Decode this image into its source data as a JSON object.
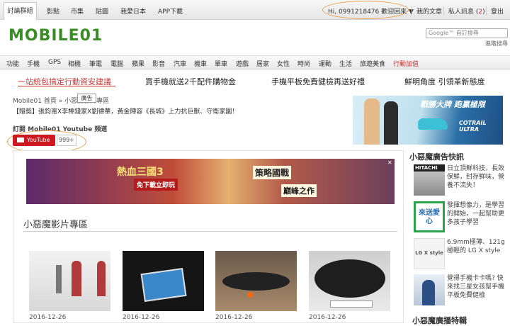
{
  "top_nav": {
    "items": [
      "討論群組",
      "影點",
      "市集",
      "貼圖",
      "我愛日本",
      "APP下載"
    ],
    "greeting": "Hi, 0991218476 歡迎回來",
    "right_items": [
      "我的文章",
      "私人訊息",
      "2",
      "登出"
    ]
  },
  "header": {
    "logo": "MOBILE01",
    "search_placeholder": "Google™ 自訂搜尋",
    "advanced_search": "進階搜尋"
  },
  "categories": [
    "功能",
    "手機",
    "GPS",
    "相機",
    "筆電",
    "電腦",
    "蘋果",
    "影音",
    "汽車",
    "機車",
    "單車",
    "遊戲",
    "居家",
    "女性",
    "時尚",
    "運動",
    "生活",
    "旅遊美食",
    "行動加值"
  ],
  "promo": [
    "一站統包搞定行動資安建議",
    "買手機就送2千配件購物金",
    "手機平板免費健檢再送好禮",
    "鮮明角度 引領革新態度"
  ],
  "content": {
    "breadcrumb": "Mobile01 首頁 » 小惡魔影片專區",
    "tooltip": "廣告",
    "news": "【贈獎】張鈞甯X李棒錢家X劉德華，黃金陣容《長城》上力抗巨獸、守衛家園！",
    "subscribe_label": "訂閱 Mobile01 Youtube 頻道",
    "youtube_label": "YouTube",
    "youtube_count": "999+",
    "section_title": "小惡魔影片專區",
    "right_ad": {
      "title": "戰勝大牌 跑贏極限",
      "brand": "COTRAIL ULTRA"
    },
    "banner": {
      "game": "熱血三國3",
      "badge": "免下載立即玩",
      "slogan1": "策略國戰",
      "slogan2": "巔峰之作"
    }
  },
  "videos": [
    {
      "date": "2016-12-26"
    },
    {
      "date": "2016-12-26"
    },
    {
      "date": "2016-12-26"
    },
    {
      "date": "2016-12-26"
    }
  ],
  "sidebar": {
    "heading": "小惡魔廣告快訊",
    "items": [
      {
        "text": "日立頂鮮科技，長效保鮮，封存鮮味，營養不流失！",
        "thumb_label": "HITACHI"
      },
      {
        "text": "發揮想像力，是學習的開始，一起幫助更多孩子學習",
        "thumb_label": "來送愛心"
      },
      {
        "text": "6.9mm極薄、121g極輕的 LG X style",
        "thumb_label": "LG X style"
      },
      {
        "text": "覺得手機卡卡嗎? 快來找三星女孩幫手機平板免費健檢",
        "thumb_label": ""
      }
    ],
    "heading2": "小惡魔廣播特輯"
  },
  "colors": {
    "brand_green": "#3a8c26",
    "youtube_red": "#cc181e",
    "annotation_orange": "#e8a04a",
    "promo_red": "#c33"
  }
}
